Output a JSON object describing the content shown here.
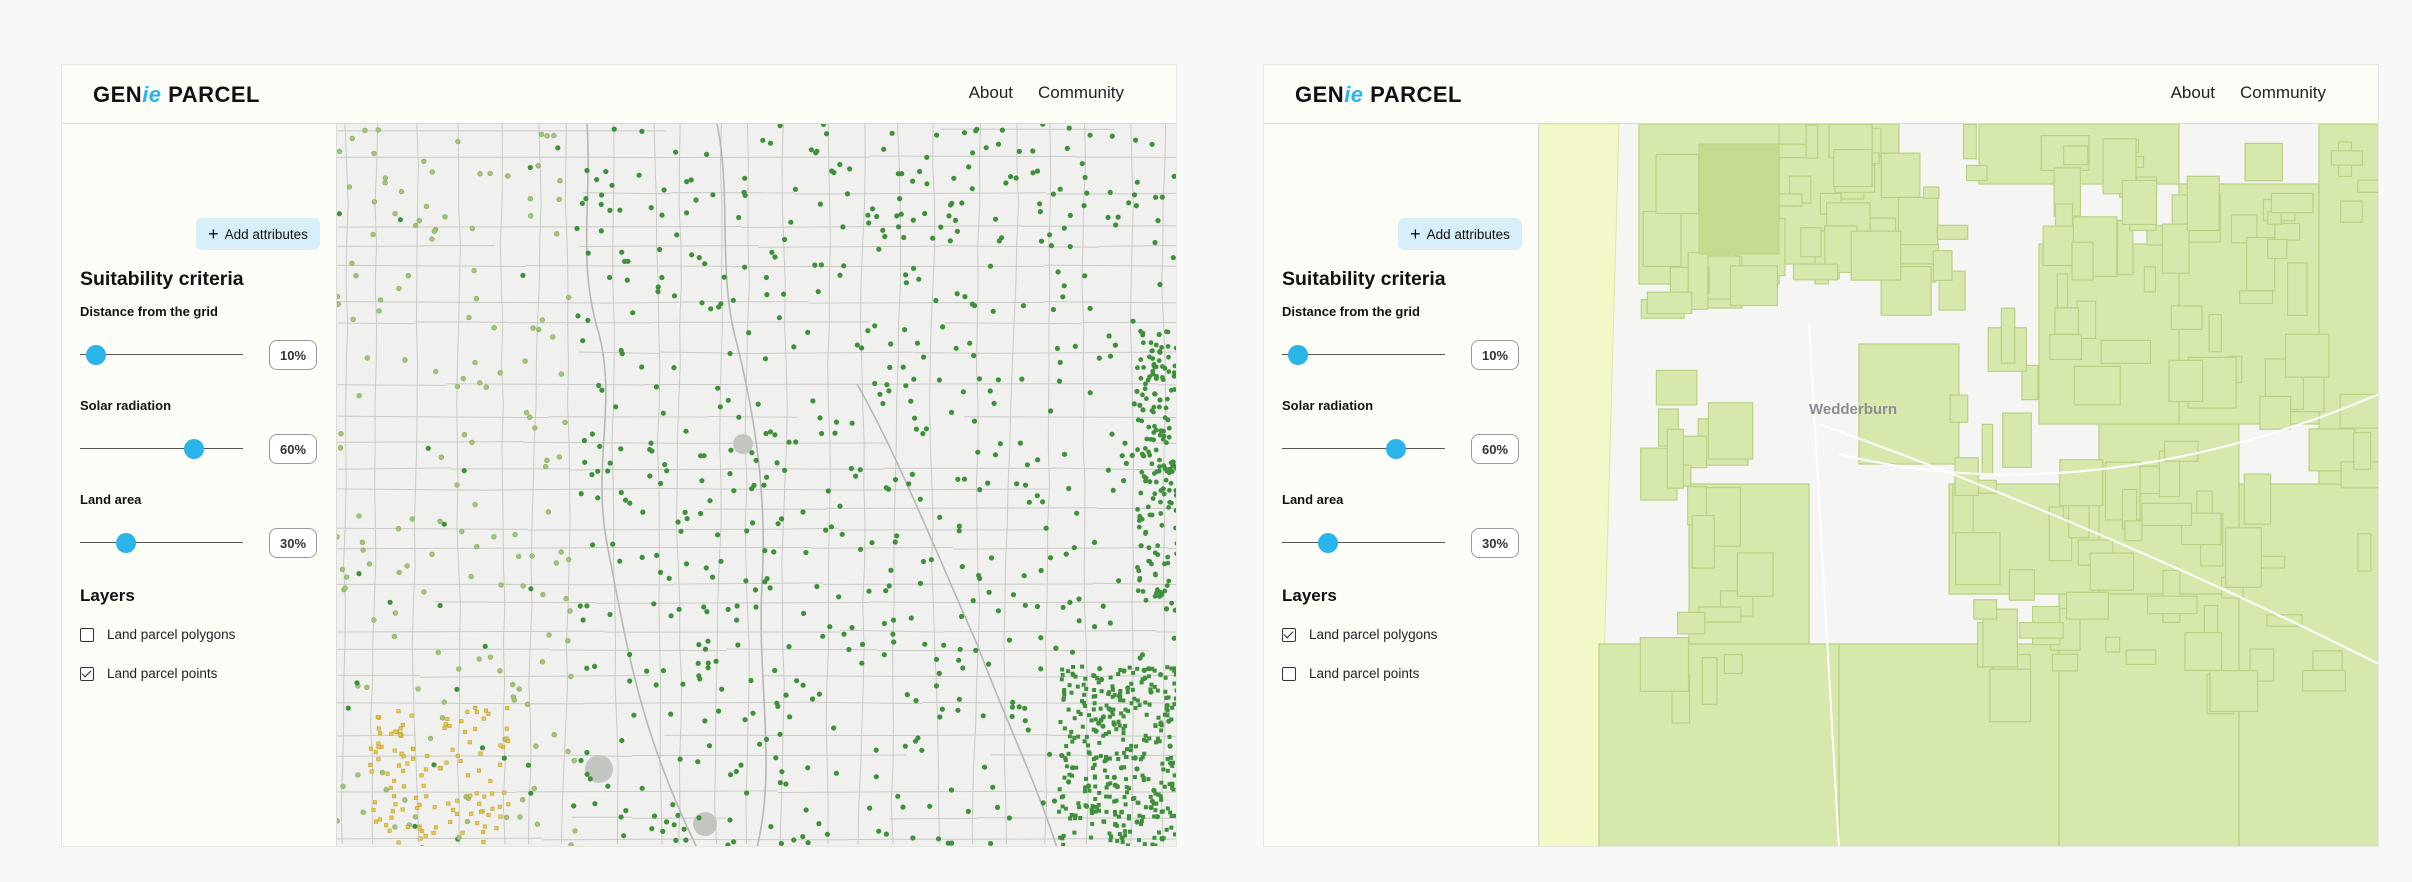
{
  "screens": [
    {
      "header": {
        "logo_pre": "GEN",
        "logo_ie": "ie",
        "logo_post": " PARCEL",
        "nav": [
          "About",
          "Community"
        ]
      },
      "sidebar": {
        "add_button_label": "Add attributes",
        "criteria_title": "Suitability criteria",
        "criteria": [
          {
            "label": "Distance from the grid",
            "value": "10%",
            "slider_fraction": 0.1
          },
          {
            "label": "Solar radiation",
            "value": "60%",
            "slider_fraction": 0.7
          },
          {
            "label": "Land area",
            "value": "30%",
            "slider_fraction": 0.28
          }
        ],
        "layers_title": "Layers",
        "layers": [
          {
            "label": "Land parcel polygons",
            "checked": false
          },
          {
            "label": "Land parcel points",
            "checked": true
          }
        ]
      },
      "map": {
        "mode": "points",
        "colors": {
          "background": "#f0f0ee",
          "grid": "#c9c9c6",
          "points": "#3f8f3c",
          "points_light": "#a3c37d"
        }
      }
    },
    {
      "header": {
        "logo_pre": "GEN",
        "logo_ie": "ie",
        "logo_post": " PARCEL",
        "nav": [
          "About",
          "Community"
        ]
      },
      "sidebar": {
        "add_button_label": "Add attributes",
        "criteria_title": "Suitability criteria",
        "criteria": [
          {
            "label": "Distance from the grid",
            "value": "10%",
            "slider_fraction": 0.1
          },
          {
            "label": "Solar radiation",
            "value": "60%",
            "slider_fraction": 0.7
          },
          {
            "label": "Land area",
            "value": "30%",
            "slider_fraction": 0.28
          }
        ],
        "layers_title": "Layers",
        "layers": [
          {
            "label": "Land parcel polygons",
            "checked": true
          },
          {
            "label": "Land parcel points",
            "checked": false
          }
        ]
      },
      "map": {
        "mode": "polygons",
        "town_label": "Wedderburn",
        "colors": {
          "background": "#f5f5f3",
          "polygon_fill": "#d7e8ad",
          "polygon_stroke": "#b8d184",
          "pale_fill": "#f4f7c8"
        }
      }
    }
  ],
  "theme": {
    "accent": "#2ab4ea",
    "button_bg": "#d7eff9",
    "panel_bg": "#fdfdf8"
  }
}
